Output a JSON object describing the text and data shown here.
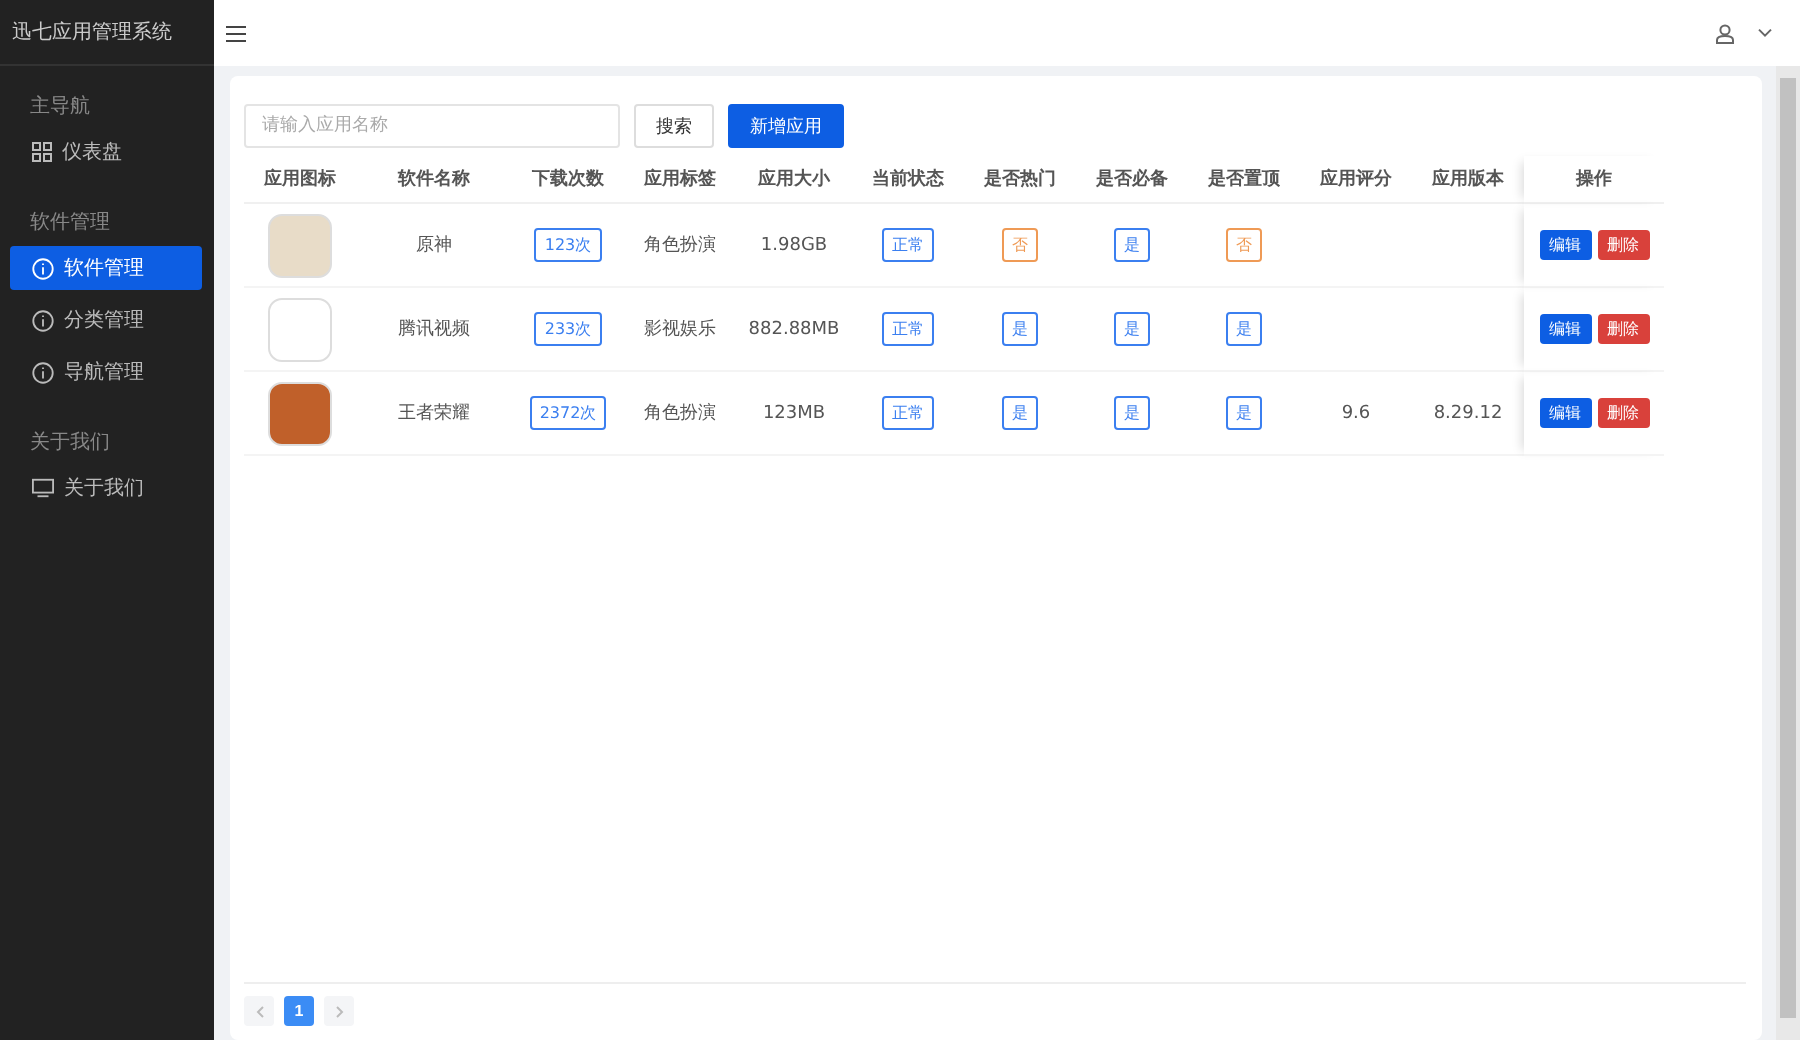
{
  "app_title": "迅七应用管理系统",
  "sidebar": {
    "sections": [
      {
        "title": "主导航",
        "items": [
          {
            "label": "仪表盘",
            "kind": "grid",
            "selected": false
          }
        ]
      },
      {
        "title": "软件管理",
        "items": [
          {
            "label": "软件管理",
            "kind": "info",
            "selected": true
          },
          {
            "label": "分类管理",
            "kind": "info",
            "selected": false
          },
          {
            "label": "导航管理",
            "kind": "info",
            "selected": false
          }
        ]
      },
      {
        "title": "关于我们",
        "items": [
          {
            "label": "关于我们",
            "kind": "monitor",
            "selected": false
          }
        ]
      }
    ]
  },
  "toolbar": {
    "search_placeholder": "请输入应用名称",
    "search_button": "搜索",
    "add_button": "新增应用"
  },
  "table": {
    "columns": [
      "应用图标",
      "软件名称",
      "下载次数",
      "应用标签",
      "应用大小",
      "当前状态",
      "是否热门",
      "是否必备",
      "是否置顶",
      "应用评分",
      "应用版本",
      "操作"
    ],
    "rows": [
      {
        "name": "原神",
        "downloads": "123次",
        "tag": "角色扮演",
        "size": "1.98GB",
        "status": "正常",
        "hot": {
          "text": "否",
          "on": false
        },
        "must": {
          "text": "是",
          "on": true
        },
        "top": {
          "text": "否",
          "on": false
        },
        "actions": [
          "编辑",
          "删除"
        ]
      },
      {
        "name": "腾讯视频",
        "downloads": "233次",
        "tag": "影视娱乐",
        "size": "882.88MB",
        "status": "正常",
        "hot": {
          "text": "是",
          "on": true
        },
        "must": {
          "text": "是",
          "on": true
        },
        "top": {
          "text": "是",
          "on": true
        },
        "actions": [
          "编辑",
          "删除"
        ]
      },
      {
        "name": "王者荣耀",
        "downloads": "2372次",
        "tag": "角色扮演",
        "size": "123MB",
        "status": "正常",
        "hot": {
          "text": "是",
          "on": true
        },
        "must": {
          "text": "是",
          "on": true
        },
        "top": {
          "text": "是",
          "on": true
        },
        "rating": "9.6",
        "version": "8.29.12",
        "actions": [
          "编辑",
          "删除"
        ]
      }
    ]
  },
  "pagination": {
    "pages": [
      {
        "label": "1",
        "selected": true
      }
    ]
  }
}
